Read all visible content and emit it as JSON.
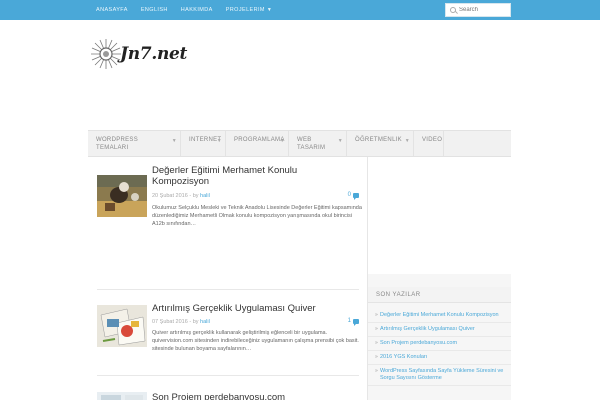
{
  "topnav": {
    "items": [
      "ANASAYFA",
      "ENGLISH",
      "HAKKIMDA",
      "PROJELERIM"
    ],
    "search_placeholder": "Search"
  },
  "logo": {
    "text": "Jn7.net"
  },
  "mainnav": {
    "items": [
      {
        "label": "WORDPRESS TEMALARI",
        "has_caret": true
      },
      {
        "label": "INTERNET",
        "has_caret": true
      },
      {
        "label": "PROGRAMLAMA",
        "has_caret": true
      },
      {
        "label": "WEB TASARIM",
        "has_caret": true
      },
      {
        "label": "ÖĞRETMENLIK",
        "has_caret": true
      },
      {
        "label": "VIDEO",
        "has_caret": false
      }
    ]
  },
  "posts": [
    {
      "title": "Değerler Eğitimi Merhamet Konulu Kompozisyon",
      "date": "20 Şubat 2016",
      "by": "- by",
      "author": "halil",
      "comments": "0",
      "excerpt": "Okulumuz Selçuklu Mesleki ve Teknik Anadolu Lisesinde Değerler Eğitimi kapsamında düzenlediğimiz Merhametli Olmak konulu kompozisyon yarışmasında okul birincisi A12b sınıfından…"
    },
    {
      "title": "Artırılmış Gerçeklik Uygulaması Quiver",
      "date": "07 Şubat 2016",
      "by": "- by",
      "author": "halil",
      "comments": "1",
      "excerpt": "Quiver artırılmış gerçeklik kullanarak geliştirilmiş eğlenceli bir uygulama. quivervision.com sitesinden indirebileceğiniz uygulamanın çalışma prensibi çok basit. sitesinde bulunan boyama sayfalarının…"
    },
    {
      "title": "Son Projem perdebanyosu.com"
    }
  ],
  "sidebar": {
    "heading": "SON YAZILAR",
    "items": [
      "Değerler Eğitimi Merhamet Konulu Kompozisyon",
      "Artırılmış Gerçeklik Uygulaması Quiver",
      "Son Projem perdebanyosu.com",
      "2016 YGS Konuları",
      "WordPress Sayfasında Sayfa Yükleme Süresini ve Sorgu Sayısını Gösterme"
    ]
  }
}
